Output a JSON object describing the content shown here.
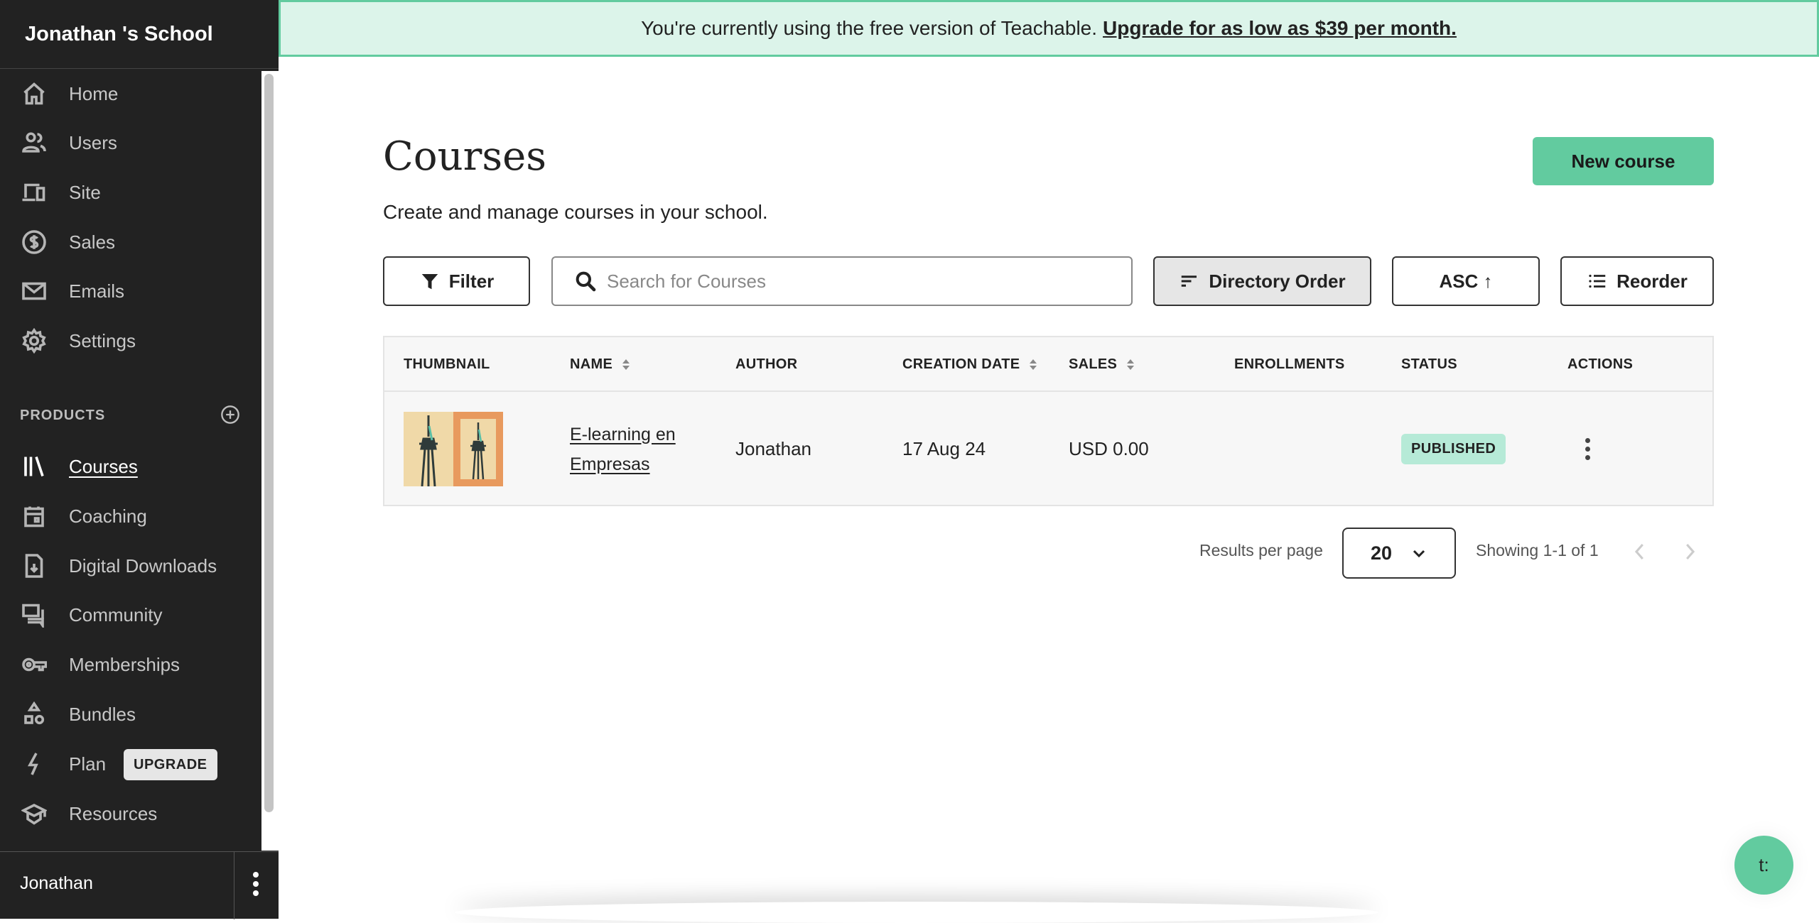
{
  "sidebar": {
    "school_name": "Jonathan 's School",
    "main_items": [
      {
        "label": "Home",
        "icon": "home-icon"
      },
      {
        "label": "Users",
        "icon": "users-icon"
      },
      {
        "label": "Site",
        "icon": "devices-icon"
      },
      {
        "label": "Sales",
        "icon": "dollar-circle-icon"
      },
      {
        "label": "Emails",
        "icon": "mail-icon"
      },
      {
        "label": "Settings",
        "icon": "gear-icon"
      }
    ],
    "products_label": "PRODUCTS",
    "product_items": [
      {
        "label": "Courses",
        "icon": "library-icon",
        "active": true
      },
      {
        "label": "Coaching",
        "icon": "calendar-icon"
      },
      {
        "label": "Digital Downloads",
        "icon": "file-download-icon"
      },
      {
        "label": "Community",
        "icon": "chat-bubbles-icon"
      },
      {
        "label": "Memberships",
        "icon": "key-icon"
      },
      {
        "label": "Bundles",
        "icon": "shapes-icon"
      },
      {
        "label": "Plan",
        "icon": "lightning-icon"
      },
      {
        "label": "Resources",
        "icon": "graduation-cap-icon"
      }
    ],
    "upgrade_badge": "UPGRADE",
    "footer_user": "Jonathan"
  },
  "banner": {
    "text": "You're currently using the free version of Teachable.",
    "link": "Upgrade for as low as $39 per month."
  },
  "header": {
    "title": "Courses",
    "subtitle": "Create and manage courses in your school.",
    "new_course_label": "New course"
  },
  "toolbar": {
    "filter_label": "Filter",
    "search_placeholder": "Search for Courses",
    "search_value": "",
    "order_label": "Directory Order",
    "direction_label": "ASC ↑",
    "reorder_label": "Reorder"
  },
  "table": {
    "columns": [
      "THUMBNAIL",
      "NAME",
      "AUTHOR",
      "CREATION DATE",
      "SALES",
      "ENROLLMENTS",
      "STATUS",
      "ACTIONS"
    ],
    "rows": [
      {
        "name": "E-learning en Empresas",
        "author": "Jonathan",
        "creation_date": "17 Aug 24",
        "sales": "USD 0.00",
        "enrollments": "",
        "status": "PUBLISHED"
      }
    ]
  },
  "pagination": {
    "results_per_page_label": "Results per page",
    "results_per_page_value": "20",
    "showing": "Showing 1-1 of 1"
  },
  "chat_widget": {
    "label": "t:"
  },
  "colors": {
    "brand_green": "#62cb9f",
    "banner_bg": "#dcf4ea",
    "sidebar_bg": "#222222",
    "badge_published": "#b6ead7"
  }
}
